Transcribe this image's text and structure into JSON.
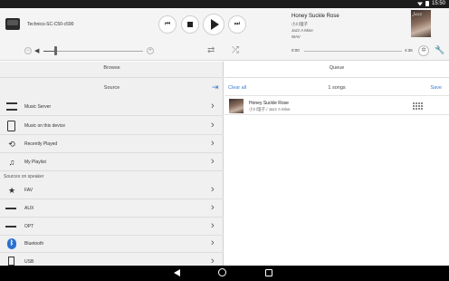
{
  "status_bar": {
    "time": "15:50"
  },
  "player": {
    "device_name": "Technics-SC-C50-c590",
    "prev_label": "⏮",
    "next_label": "⏭",
    "volume_fraction": 0.12,
    "vol_minus": "−",
    "vol_plus": "+",
    "track": {
      "title": "Honey Suckle Rose",
      "artist": "小川理子",
      "album": "Jazz A Mise",
      "format": "WAV",
      "time_start": "0:00",
      "time_end": "4:36",
      "progress_fraction": 0.0
    },
    "album_art_text": "Jazz"
  },
  "browse": {
    "title": "Browse",
    "source_title": "Source",
    "items": [
      {
        "label": "Music Server",
        "icon": "server-icon"
      },
      {
        "label": "Music on this device",
        "icon": "tablet-icon"
      },
      {
        "label": "Recently Played",
        "icon": "history-icon",
        "glyph": "⟲"
      },
      {
        "label": "My Playlist",
        "icon": "playlist-icon",
        "glyph": "♫"
      }
    ],
    "speaker_section_label": "Sources on speaker",
    "speaker_items": [
      {
        "label": "FAV",
        "icon": "star-icon",
        "glyph": "★"
      },
      {
        "label": "AUX",
        "icon": "cable-icon"
      },
      {
        "label": "OPT",
        "icon": "optical-icon"
      },
      {
        "label": "Bluetooth",
        "icon": "bluetooth-icon",
        "glyph": "ᛒ"
      },
      {
        "label": "USB",
        "icon": "usb-icon"
      }
    ],
    "chevron": "›"
  },
  "queue": {
    "title": "Queue",
    "clear_all": "Clear all",
    "count": "1 songs",
    "save": "Save",
    "items": [
      {
        "title": "Honey Suckle Rose",
        "subtitle": "小川理子 / Jazz A Mise"
      }
    ]
  },
  "colors": {
    "accent": "#3b7ed0",
    "panel": "#f0f0f0"
  }
}
